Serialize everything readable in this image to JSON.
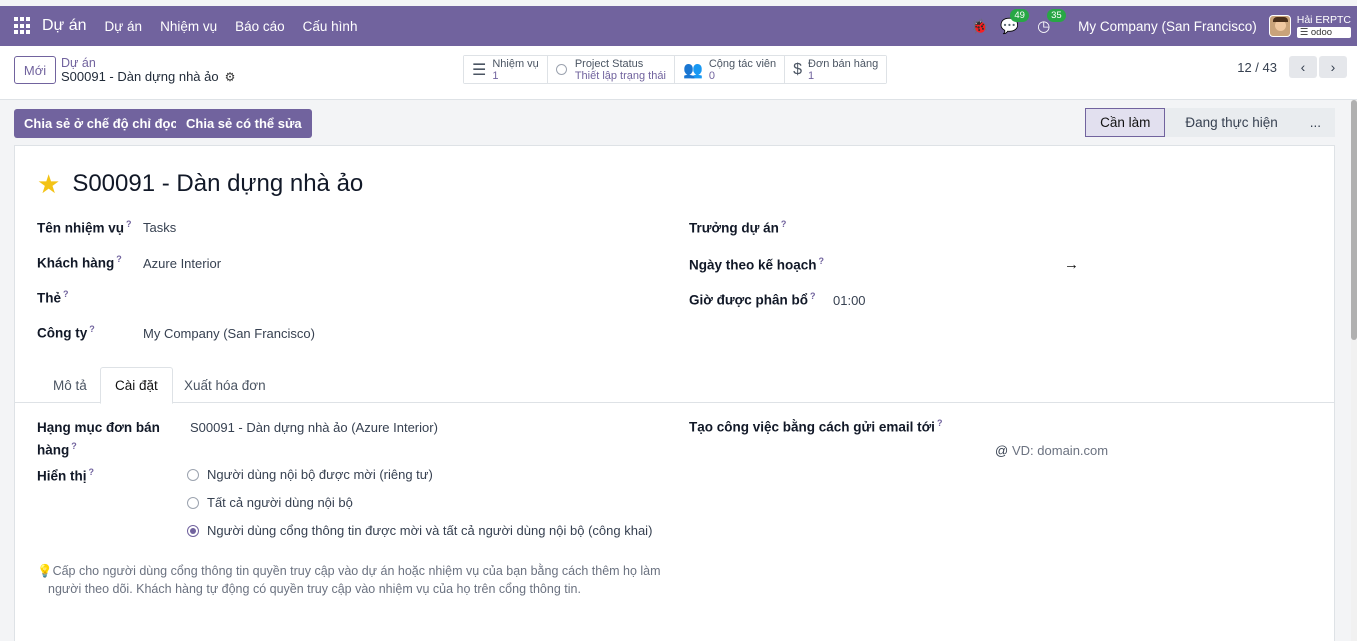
{
  "navbar": {
    "brand": "Dự án",
    "menu": [
      "Dự án",
      "Nhiệm vụ",
      "Báo cáo",
      "Cấu hình"
    ],
    "chat_count": "49",
    "activity_count": "35",
    "company": "My Company (San Francisco)",
    "user": "Hải ERPTC",
    "db": "odoo"
  },
  "control": {
    "new_label": "Mới",
    "breadcrumb_parent": "Dự án",
    "breadcrumb_current": "S00091 - Dàn dựng nhà ảo",
    "smart_buttons": [
      {
        "label": "Nhiệm vụ",
        "value": "1",
        "icon": "tasks-icon"
      },
      {
        "label": "Project Status",
        "value": "Thiết lập trạng thái",
        "icon": "status-radio-icon"
      },
      {
        "label": "Cộng tác viên",
        "value": "0",
        "icon": "users-icon"
      },
      {
        "label": "Đơn bán hàng",
        "value": "1",
        "icon": "dollar-icon"
      }
    ],
    "pager": "12 / 43"
  },
  "statusbar": {
    "share_readonly": "Chia sẻ ở chế độ chỉ đọc",
    "share_edit": "Chia sẻ có thể sửa",
    "stages": [
      "Cần làm",
      "Đang thực hiện",
      "..."
    ]
  },
  "form": {
    "title": "S00091 - Dàn dựng nhà ảo",
    "fields_left": [
      {
        "label": "Tên nhiệm vụ",
        "value": "Tasks"
      },
      {
        "label": "Khách hàng",
        "value": "Azure Interior"
      },
      {
        "label": "Thẻ",
        "value": ""
      },
      {
        "label": "Công ty",
        "value": "My Company (San Francisco)"
      }
    ],
    "fields_right": [
      {
        "label": "Trưởng dự án",
        "value": ""
      },
      {
        "label": "Ngày theo kế hoạch",
        "value": "→"
      },
      {
        "label": "Giờ được phân bổ",
        "value": "01:00"
      }
    ],
    "tabs": [
      "Mô tả",
      "Cài đặt",
      "Xuất hóa đơn"
    ],
    "settings": {
      "sale_line_label_1": "Hạng mục đơn bán",
      "sale_line_label_2": "hàng",
      "sale_line_value": "S00091 - Dàn dựng nhà ảo (Azure Interior)",
      "visibility_label": "Hiển thị",
      "visibility_options": [
        "Người dùng nội bộ được mời (riêng tư)",
        "Tất cả người dùng nội bộ",
        "Người dùng cổng thông tin được mời và tất cả người dùng nội bộ (công khai)"
      ],
      "email_label": "Tạo công việc bằng cách gửi email tới",
      "email_at": "@",
      "email_placeholder": "VD: domain.com",
      "help_text_1": "Cấp cho người dùng cổng thông tin quyền truy cập vào dự án hoặc nhiệm vụ của bạn bằng cách thêm họ làm",
      "help_text_2": "người theo dõi. Khách hàng tự động có quyền truy cập vào nhiệm vụ của họ trên cổng thông tin."
    }
  },
  "colors": {
    "brand": "#71639e",
    "star": "#f3c316",
    "badge": "#28a745"
  }
}
